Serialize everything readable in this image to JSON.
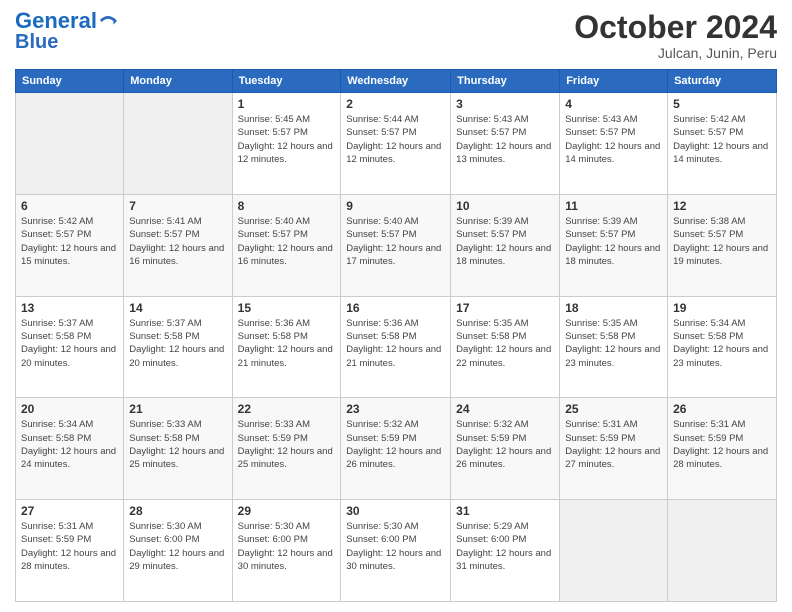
{
  "logo": {
    "line1": "General",
    "line2": "Blue"
  },
  "header": {
    "title": "October 2024",
    "subtitle": "Julcan, Junin, Peru"
  },
  "weekdays": [
    "Sunday",
    "Monday",
    "Tuesday",
    "Wednesday",
    "Thursday",
    "Friday",
    "Saturday"
  ],
  "weeks": [
    [
      {
        "day": "",
        "sunrise": "",
        "sunset": "",
        "daylight": ""
      },
      {
        "day": "",
        "sunrise": "",
        "sunset": "",
        "daylight": ""
      },
      {
        "day": "1",
        "sunrise": "Sunrise: 5:45 AM",
        "sunset": "Sunset: 5:57 PM",
        "daylight": "Daylight: 12 hours and 12 minutes."
      },
      {
        "day": "2",
        "sunrise": "Sunrise: 5:44 AM",
        "sunset": "Sunset: 5:57 PM",
        "daylight": "Daylight: 12 hours and 12 minutes."
      },
      {
        "day": "3",
        "sunrise": "Sunrise: 5:43 AM",
        "sunset": "Sunset: 5:57 PM",
        "daylight": "Daylight: 12 hours and 13 minutes."
      },
      {
        "day": "4",
        "sunrise": "Sunrise: 5:43 AM",
        "sunset": "Sunset: 5:57 PM",
        "daylight": "Daylight: 12 hours and 14 minutes."
      },
      {
        "day": "5",
        "sunrise": "Sunrise: 5:42 AM",
        "sunset": "Sunset: 5:57 PM",
        "daylight": "Daylight: 12 hours and 14 minutes."
      }
    ],
    [
      {
        "day": "6",
        "sunrise": "Sunrise: 5:42 AM",
        "sunset": "Sunset: 5:57 PM",
        "daylight": "Daylight: 12 hours and 15 minutes."
      },
      {
        "day": "7",
        "sunrise": "Sunrise: 5:41 AM",
        "sunset": "Sunset: 5:57 PM",
        "daylight": "Daylight: 12 hours and 16 minutes."
      },
      {
        "day": "8",
        "sunrise": "Sunrise: 5:40 AM",
        "sunset": "Sunset: 5:57 PM",
        "daylight": "Daylight: 12 hours and 16 minutes."
      },
      {
        "day": "9",
        "sunrise": "Sunrise: 5:40 AM",
        "sunset": "Sunset: 5:57 PM",
        "daylight": "Daylight: 12 hours and 17 minutes."
      },
      {
        "day": "10",
        "sunrise": "Sunrise: 5:39 AM",
        "sunset": "Sunset: 5:57 PM",
        "daylight": "Daylight: 12 hours and 18 minutes."
      },
      {
        "day": "11",
        "sunrise": "Sunrise: 5:39 AM",
        "sunset": "Sunset: 5:57 PM",
        "daylight": "Daylight: 12 hours and 18 minutes."
      },
      {
        "day": "12",
        "sunrise": "Sunrise: 5:38 AM",
        "sunset": "Sunset: 5:57 PM",
        "daylight": "Daylight: 12 hours and 19 minutes."
      }
    ],
    [
      {
        "day": "13",
        "sunrise": "Sunrise: 5:37 AM",
        "sunset": "Sunset: 5:58 PM",
        "daylight": "Daylight: 12 hours and 20 minutes."
      },
      {
        "day": "14",
        "sunrise": "Sunrise: 5:37 AM",
        "sunset": "Sunset: 5:58 PM",
        "daylight": "Daylight: 12 hours and 20 minutes."
      },
      {
        "day": "15",
        "sunrise": "Sunrise: 5:36 AM",
        "sunset": "Sunset: 5:58 PM",
        "daylight": "Daylight: 12 hours and 21 minutes."
      },
      {
        "day": "16",
        "sunrise": "Sunrise: 5:36 AM",
        "sunset": "Sunset: 5:58 PM",
        "daylight": "Daylight: 12 hours and 21 minutes."
      },
      {
        "day": "17",
        "sunrise": "Sunrise: 5:35 AM",
        "sunset": "Sunset: 5:58 PM",
        "daylight": "Daylight: 12 hours and 22 minutes."
      },
      {
        "day": "18",
        "sunrise": "Sunrise: 5:35 AM",
        "sunset": "Sunset: 5:58 PM",
        "daylight": "Daylight: 12 hours and 23 minutes."
      },
      {
        "day": "19",
        "sunrise": "Sunrise: 5:34 AM",
        "sunset": "Sunset: 5:58 PM",
        "daylight": "Daylight: 12 hours and 23 minutes."
      }
    ],
    [
      {
        "day": "20",
        "sunrise": "Sunrise: 5:34 AM",
        "sunset": "Sunset: 5:58 PM",
        "daylight": "Daylight: 12 hours and 24 minutes."
      },
      {
        "day": "21",
        "sunrise": "Sunrise: 5:33 AM",
        "sunset": "Sunset: 5:58 PM",
        "daylight": "Daylight: 12 hours and 25 minutes."
      },
      {
        "day": "22",
        "sunrise": "Sunrise: 5:33 AM",
        "sunset": "Sunset: 5:59 PM",
        "daylight": "Daylight: 12 hours and 25 minutes."
      },
      {
        "day": "23",
        "sunrise": "Sunrise: 5:32 AM",
        "sunset": "Sunset: 5:59 PM",
        "daylight": "Daylight: 12 hours and 26 minutes."
      },
      {
        "day": "24",
        "sunrise": "Sunrise: 5:32 AM",
        "sunset": "Sunset: 5:59 PM",
        "daylight": "Daylight: 12 hours and 26 minutes."
      },
      {
        "day": "25",
        "sunrise": "Sunrise: 5:31 AM",
        "sunset": "Sunset: 5:59 PM",
        "daylight": "Daylight: 12 hours and 27 minutes."
      },
      {
        "day": "26",
        "sunrise": "Sunrise: 5:31 AM",
        "sunset": "Sunset: 5:59 PM",
        "daylight": "Daylight: 12 hours and 28 minutes."
      }
    ],
    [
      {
        "day": "27",
        "sunrise": "Sunrise: 5:31 AM",
        "sunset": "Sunset: 5:59 PM",
        "daylight": "Daylight: 12 hours and 28 minutes."
      },
      {
        "day": "28",
        "sunrise": "Sunrise: 5:30 AM",
        "sunset": "Sunset: 6:00 PM",
        "daylight": "Daylight: 12 hours and 29 minutes."
      },
      {
        "day": "29",
        "sunrise": "Sunrise: 5:30 AM",
        "sunset": "Sunset: 6:00 PM",
        "daylight": "Daylight: 12 hours and 30 minutes."
      },
      {
        "day": "30",
        "sunrise": "Sunrise: 5:30 AM",
        "sunset": "Sunset: 6:00 PM",
        "daylight": "Daylight: 12 hours and 30 minutes."
      },
      {
        "day": "31",
        "sunrise": "Sunrise: 5:29 AM",
        "sunset": "Sunset: 6:00 PM",
        "daylight": "Daylight: 12 hours and 31 minutes."
      },
      {
        "day": "",
        "sunrise": "",
        "sunset": "",
        "daylight": ""
      },
      {
        "day": "",
        "sunrise": "",
        "sunset": "",
        "daylight": ""
      }
    ]
  ]
}
